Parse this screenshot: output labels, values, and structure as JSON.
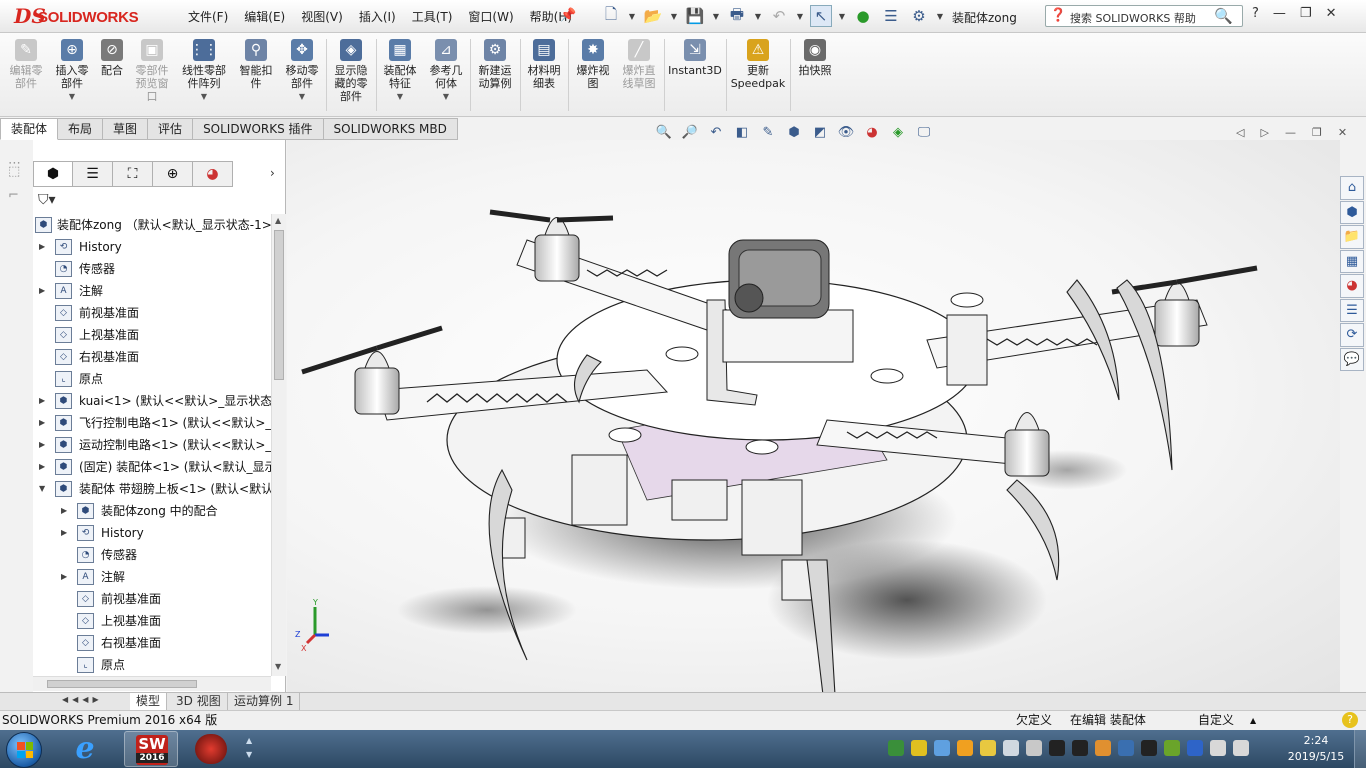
{
  "app": {
    "logo_prefix": "DS",
    "logo_text": "SOLIDWORKS",
    "document_title": "装配体zong"
  },
  "menu": [
    "文件(F)",
    "编辑(E)",
    "视图(V)",
    "插入(I)",
    "工具(T)",
    "窗口(W)",
    "帮助(H)"
  ],
  "search": {
    "placeholder": "搜索 SOLIDWORKS 帮助"
  },
  "ribbon": {
    "groups": [
      {
        "label": "编辑零部件",
        "disabled": true
      },
      {
        "label": "插入零部件",
        "disabled": false
      },
      {
        "label": "配合",
        "disabled": false
      },
      {
        "label": "零部件预览窗口",
        "disabled": true
      },
      {
        "label": "线性零部件阵列",
        "disabled": false
      },
      {
        "label": "智能扣件",
        "disabled": false
      },
      {
        "label": "移动零部件",
        "disabled": false
      },
      {
        "label": "显示隐藏的零部件",
        "disabled": false
      },
      {
        "label": "装配体特征",
        "disabled": false
      },
      {
        "label": "参考几何体",
        "disabled": false
      },
      {
        "label": "新建运动算例",
        "disabled": false
      },
      {
        "label": "材料明细表",
        "disabled": false
      },
      {
        "label": "爆炸视图",
        "disabled": false
      },
      {
        "label": "爆炸直线草图",
        "disabled": true
      },
      {
        "label": "Instant3D",
        "disabled": false
      },
      {
        "label": "更新Speedpak",
        "disabled": false
      },
      {
        "label": "拍快照",
        "disabled": false
      }
    ]
  },
  "command_tabs": [
    "装配体",
    "布局",
    "草图",
    "评估",
    "SOLIDWORKS 插件",
    "SOLIDWORKS MBD"
  ],
  "tree": {
    "root": "装配体zong （默认<默认_显示状态-1>）",
    "items": [
      {
        "label": "History",
        "indent": 1,
        "expand": "right"
      },
      {
        "label": "传感器",
        "indent": 1,
        "expand": ""
      },
      {
        "label": "注解",
        "indent": 1,
        "expand": "right"
      },
      {
        "label": "前视基准面",
        "indent": 1,
        "expand": ""
      },
      {
        "label": "上视基准面",
        "indent": 1,
        "expand": ""
      },
      {
        "label": "右视基准面",
        "indent": 1,
        "expand": ""
      },
      {
        "label": "原点",
        "indent": 1,
        "expand": ""
      },
      {
        "label": "kuai<1> (默认<<默认>_显示状态",
        "indent": 1,
        "expand": "right"
      },
      {
        "label": "飞行控制电路<1> (默认<<默认>_显",
        "indent": 1,
        "expand": "right"
      },
      {
        "label": "运动控制电路<1> (默认<<默认>_显",
        "indent": 1,
        "expand": "right"
      },
      {
        "label": "(固定) 装配体<1> (默认<默认_显示",
        "indent": 1,
        "expand": "right"
      },
      {
        "label": "装配体 带翅膀上板<1> (默认<默认",
        "indent": 1,
        "expand": "down"
      },
      {
        "label": "装配体zong 中的配合",
        "indent": 2,
        "expand": "right"
      },
      {
        "label": "History",
        "indent": 2,
        "expand": "right"
      },
      {
        "label": "传感器",
        "indent": 2,
        "expand": ""
      },
      {
        "label": "注解",
        "indent": 2,
        "expand": "right"
      },
      {
        "label": "前视基准面",
        "indent": 2,
        "expand": ""
      },
      {
        "label": "上视基准面",
        "indent": 2,
        "expand": ""
      },
      {
        "label": "右视基准面",
        "indent": 2,
        "expand": ""
      },
      {
        "label": "原点",
        "indent": 2,
        "expand": ""
      }
    ]
  },
  "triad": {
    "x": "X",
    "y": "Y",
    "z": "Z"
  },
  "bottom_tabs": [
    "模型",
    "3D 视图",
    "运动算例 1"
  ],
  "status": {
    "product": "SOLIDWORKS Premium 2016 x64 版",
    "definition": "欠定义",
    "mode": "在编辑 装配体",
    "units": "自定义"
  },
  "taskbar": {
    "sw_label": "SW",
    "sw_year": "2016",
    "time": "2:24",
    "date": "2019/5/15"
  }
}
